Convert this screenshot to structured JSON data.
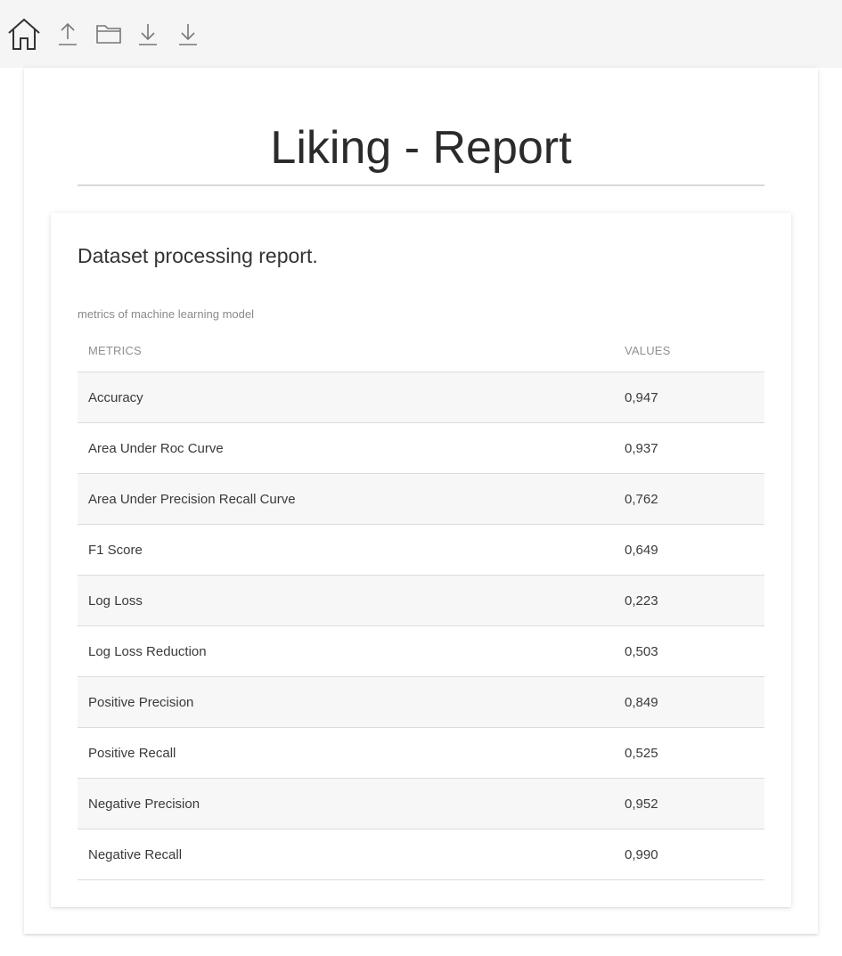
{
  "toolbar": {
    "icons": [
      "home-icon",
      "upload-icon",
      "folder-icon",
      "download-icon",
      "download-icon"
    ]
  },
  "page": {
    "title": "Liking - Report"
  },
  "report": {
    "section_title": "Dataset processing report.",
    "caption": "metrics of machine learning model",
    "columns": [
      "METRICS",
      "VALUES"
    ],
    "rows": [
      {
        "metric": "Accuracy",
        "value": "0,947"
      },
      {
        "metric": "Area Under Roc Curve",
        "value": "0,937"
      },
      {
        "metric": "Area Under Precision Recall Curve",
        "value": "0,762"
      },
      {
        "metric": "F1 Score",
        "value": "0,649"
      },
      {
        "metric": "Log Loss",
        "value": "0,223"
      },
      {
        "metric": "Log Loss Reduction",
        "value": "0,503"
      },
      {
        "metric": "Positive Precision",
        "value": "0,849"
      },
      {
        "metric": "Positive Recall",
        "value": "0,525"
      },
      {
        "metric": "Negative Precision",
        "value": "0,952"
      },
      {
        "metric": "Negative Recall",
        "value": "0,990"
      }
    ]
  },
  "colors": {
    "toolbar_bg": "#f5f5f5",
    "text": "#333333",
    "muted": "#8a8a8a",
    "row_stripe": "#f7f7f7",
    "divider": "#dcdcdc"
  }
}
